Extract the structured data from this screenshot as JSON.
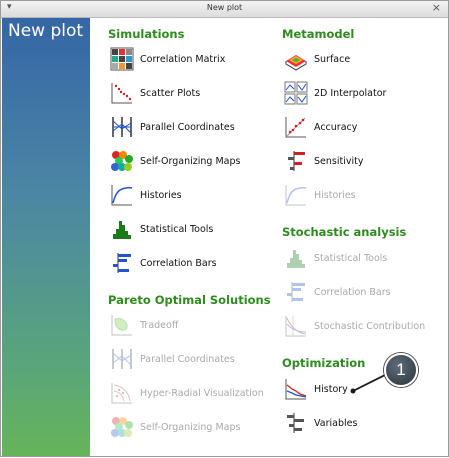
{
  "window": {
    "title": "New plot",
    "menu_glyph": "▾",
    "close_glyph": "×"
  },
  "sidebar": {
    "heading": "New plot"
  },
  "sections": {
    "simulations": {
      "title": "Simulations",
      "items": [
        {
          "label": "Correlation Matrix",
          "icon": "correlation-matrix-icon",
          "enabled": true
        },
        {
          "label": "Scatter Plots",
          "icon": "scatter-plots-icon",
          "enabled": true
        },
        {
          "label": "Parallel Coordinates",
          "icon": "parallel-coordinates-icon",
          "enabled": true
        },
        {
          "label": "Self-Organizing Maps",
          "icon": "self-organizing-maps-icon",
          "enabled": true
        },
        {
          "label": "Histories",
          "icon": "histories-icon",
          "enabled": true
        },
        {
          "label": "Statistical Tools",
          "icon": "statistical-tools-icon",
          "enabled": true
        },
        {
          "label": "Correlation Bars",
          "icon": "correlation-bars-icon",
          "enabled": true
        }
      ]
    },
    "pareto": {
      "title": "Pareto Optimal Solutions",
      "items": [
        {
          "label": "Tradeoff",
          "icon": "tradeoff-icon",
          "enabled": false
        },
        {
          "label": "Parallel Coordinates",
          "icon": "parallel-coordinates-icon",
          "enabled": false
        },
        {
          "label": "Hyper-Radial Visualization",
          "icon": "hyper-radial-icon",
          "enabled": false
        },
        {
          "label": "Self-Organizing Maps",
          "icon": "self-organizing-maps-icon",
          "enabled": false
        }
      ]
    },
    "metamodel": {
      "title": "Metamodel",
      "items": [
        {
          "label": "Surface",
          "icon": "surface-icon",
          "enabled": true
        },
        {
          "label": "2D Interpolator",
          "icon": "interpolator-icon",
          "enabled": true
        },
        {
          "label": "Accuracy",
          "icon": "accuracy-icon",
          "enabled": true
        },
        {
          "label": "Sensitivity",
          "icon": "sensitivity-icon",
          "enabled": true
        },
        {
          "label": "Histories",
          "icon": "histories-icon",
          "enabled": false
        }
      ]
    },
    "stochastic": {
      "title": "Stochastic analysis",
      "items": [
        {
          "label": "Statistical Tools",
          "icon": "statistical-tools-icon",
          "enabled": false
        },
        {
          "label": "Correlation Bars",
          "icon": "correlation-bars-icon",
          "enabled": false
        },
        {
          "label": "Stochastic Contribution",
          "icon": "stochastic-contribution-icon",
          "enabled": false
        }
      ]
    },
    "optimization": {
      "title": "Optimization",
      "items": [
        {
          "label": "History",
          "icon": "history-icon",
          "enabled": true
        },
        {
          "label": "Variables",
          "icon": "variables-icon",
          "enabled": true
        }
      ]
    }
  },
  "callout": {
    "number": "1"
  }
}
